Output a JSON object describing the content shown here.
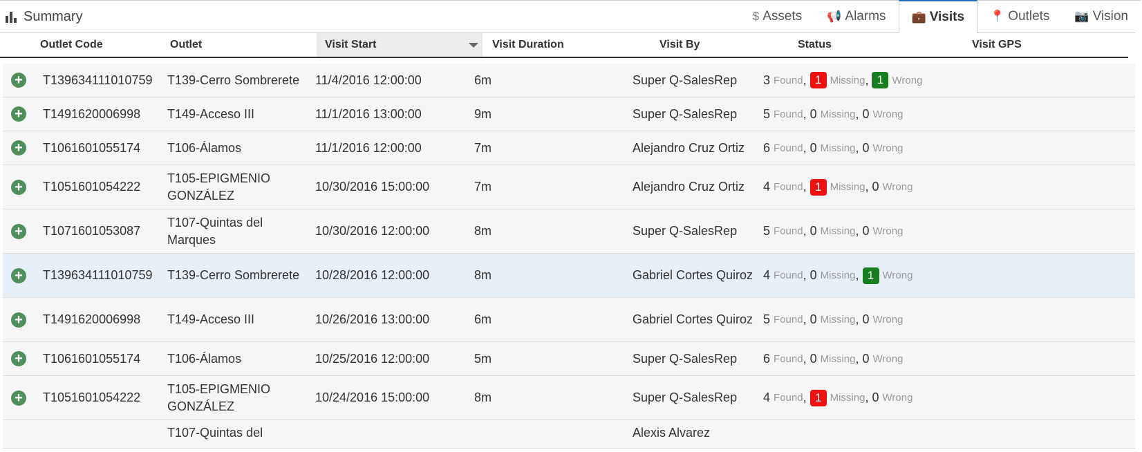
{
  "topbar": {
    "title": "Summary",
    "tabs": [
      {
        "icon": "$",
        "icon_name": "dollar-icon",
        "label": "Assets"
      },
      {
        "icon": "📢",
        "icon_name": "bullhorn-icon",
        "label": "Alarms"
      },
      {
        "icon": "💼",
        "icon_name": "briefcase-icon",
        "label": "Visits",
        "active": true
      },
      {
        "icon": "📍",
        "icon_name": "map-marker-icon",
        "label": "Outlets"
      },
      {
        "icon": "📷",
        "icon_name": "camera-icon",
        "label": "Vision"
      }
    ]
  },
  "columns": {
    "outlet_code": "Outlet Code",
    "outlet": "Outlet",
    "visit_start": "Visit Start",
    "visit_duration": "Visit Duration",
    "visit_by": "Visit By",
    "status": "Status",
    "visit_gps": "Visit GPS"
  },
  "status_labels": {
    "found": "Found",
    "missing": "Missing",
    "wrong": "Wrong"
  },
  "colors": {
    "missing_badge": "#ee1111",
    "wrong_badge": "#177e1f",
    "expand_icon": "#4f8f5b",
    "active_tab": "#2a6dbf"
  },
  "rows": [
    {
      "code": "T139634111010759",
      "outlet": "T139-Cerro Sombrerete",
      "start": "11/4/2016 12:00:00",
      "duration": "6m",
      "by": "Super Q-SalesRep",
      "found": "3",
      "missing": "1",
      "wrong": "1"
    },
    {
      "code": "T1491620006998",
      "outlet": "T149-Acceso III",
      "start": "11/1/2016 13:00:00",
      "duration": "9m",
      "by": "Super Q-SalesRep",
      "found": "5",
      "missing": "0",
      "wrong": "0"
    },
    {
      "code": "T1061601055174",
      "outlet": "T106-Álamos",
      "start": "11/1/2016 12:00:00",
      "duration": "7m",
      "by": "Alejandro Cruz Ortiz",
      "found": "6",
      "missing": "0",
      "wrong": "0"
    },
    {
      "code": "T1051601054222",
      "outlet": "T105-EPIGMENIO GONZÁLEZ",
      "start": "10/30/2016 15:00:00",
      "duration": "7m",
      "by": "Alejandro Cruz Ortiz",
      "found": "4",
      "missing": "1",
      "wrong": "0"
    },
    {
      "code": "T1071601053087",
      "outlet": "T107-Quintas del Marques",
      "start": "10/30/2016 12:00:00",
      "duration": "8m",
      "by": "Super Q-SalesRep",
      "found": "5",
      "missing": "0",
      "wrong": "0"
    },
    {
      "code": "T139634111010759",
      "outlet": "T139-Cerro Sombrerete",
      "start": "10/28/2016 12:00:00",
      "duration": "8m",
      "by": "Gabriel Cortes Quiroz",
      "found": "4",
      "missing": "0",
      "wrong": "1"
    },
    {
      "code": "T1491620006998",
      "outlet": "T149-Acceso III",
      "start": "10/26/2016 13:00:00",
      "duration": "6m",
      "by": "Gabriel Cortes Quiroz",
      "found": "5",
      "missing": "0",
      "wrong": "0"
    },
    {
      "code": "T1061601055174",
      "outlet": "T106-Álamos",
      "start": "10/25/2016 12:00:00",
      "duration": "5m",
      "by": "Super Q-SalesRep",
      "found": "6",
      "missing": "0",
      "wrong": "0"
    },
    {
      "code": "T1051601054222",
      "outlet": "T105-EPIGMENIO GONZÁLEZ",
      "start": "10/24/2016 15:00:00",
      "duration": "8m",
      "by": "Super Q-SalesRep",
      "found": "4",
      "missing": "1",
      "wrong": "0"
    },
    {
      "code": "",
      "outlet": "T107-Quintas del",
      "start": "",
      "duration": "",
      "by": "Alexis Alvarez",
      "found": "",
      "missing": "",
      "wrong": ""
    }
  ]
}
